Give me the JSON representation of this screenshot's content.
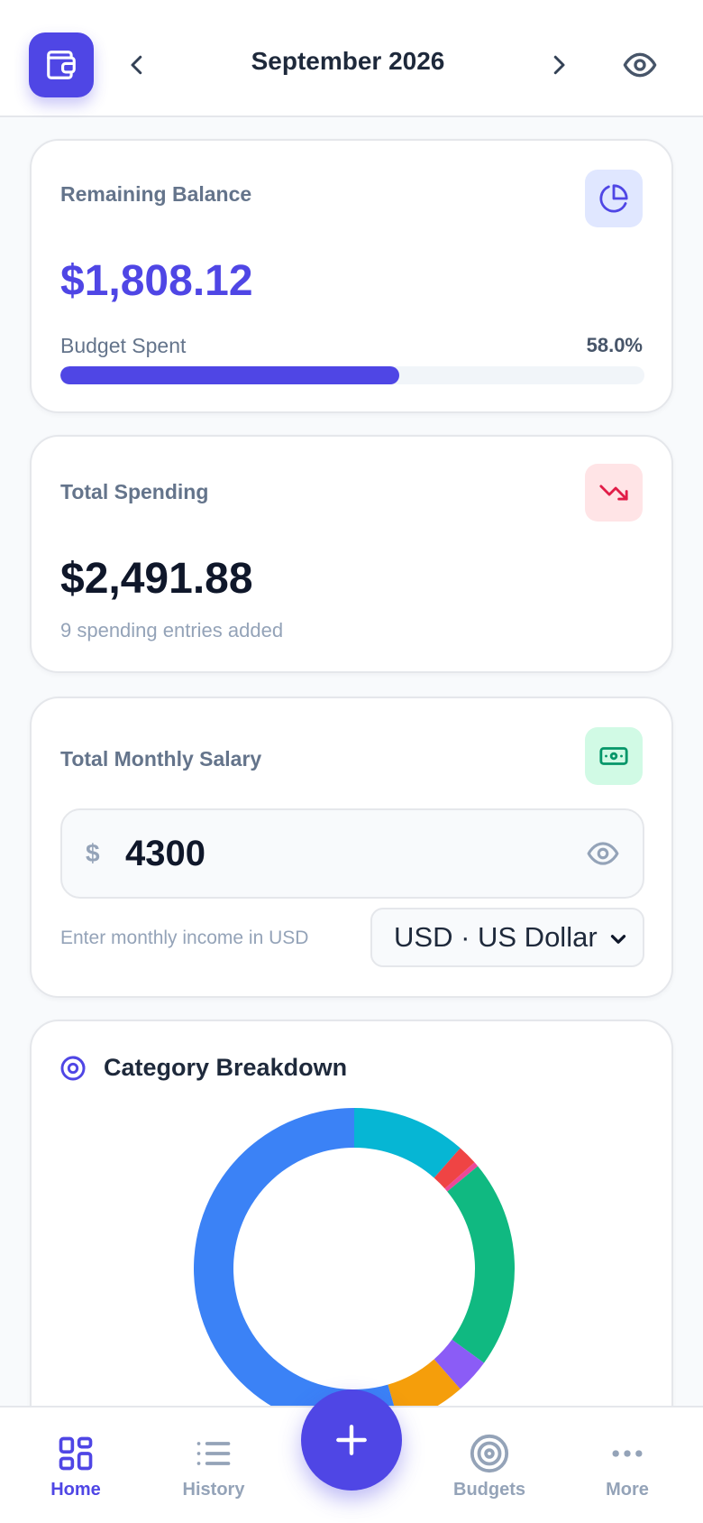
{
  "header": {
    "month_label": "September 2026",
    "icons": [
      "wallet-icon",
      "chevron-left-icon",
      "chevron-right-icon",
      "eye-icon"
    ]
  },
  "balance_card": {
    "label": "Remaining Balance",
    "value": "$1,808.12",
    "spent_label": "Budget Spent",
    "spent_pct_text": "58.0%",
    "spent_fraction": 0.58,
    "icon": "pie-chart-icon",
    "accent": "#4f46e5"
  },
  "spending_card": {
    "label": "Total Spending",
    "value": "$2,491.88",
    "subtext": "9 spending entries added",
    "icon": "trending-down-icon",
    "accent": "#e11d48"
  },
  "salary_card": {
    "label": "Total Monthly Salary",
    "currency_symbol": "$",
    "input_value": "4300",
    "hint": "Enter monthly income in USD",
    "currency_selected": "USD · US Dollar",
    "icon": "banknote-icon",
    "accent": "#059669"
  },
  "breakdown_card": {
    "title": "Category Breakdown",
    "icon": "donut-icon"
  },
  "chart_data": {
    "type": "pie",
    "style": "donut",
    "slices": [
      {
        "color": "#06b6d4",
        "value": 11.5
      },
      {
        "color": "#ef4444",
        "value": 2.0
      },
      {
        "color": "#ec4899",
        "value": 0.5
      },
      {
        "color": "#10b981",
        "value": 21.0
      },
      {
        "color": "#8b5cf6",
        "value": 3.5
      },
      {
        "color": "#f59e0b",
        "value": 7.0
      },
      {
        "color": "#3b82f6",
        "value": 54.5
      }
    ]
  },
  "bottom_nav": {
    "items": [
      {
        "label": "Home",
        "icon": "grid-icon",
        "active": true
      },
      {
        "label": "History",
        "icon": "list-icon",
        "active": false
      },
      {
        "label": "Budgets",
        "icon": "target-icon",
        "active": false
      },
      {
        "label": "More",
        "icon": "more-icon",
        "active": false
      }
    ],
    "fab_icon": "plus-icon"
  },
  "colors": {
    "primary": "#4f46e5",
    "text_muted": "#64748b",
    "background": "#f8fafc"
  }
}
